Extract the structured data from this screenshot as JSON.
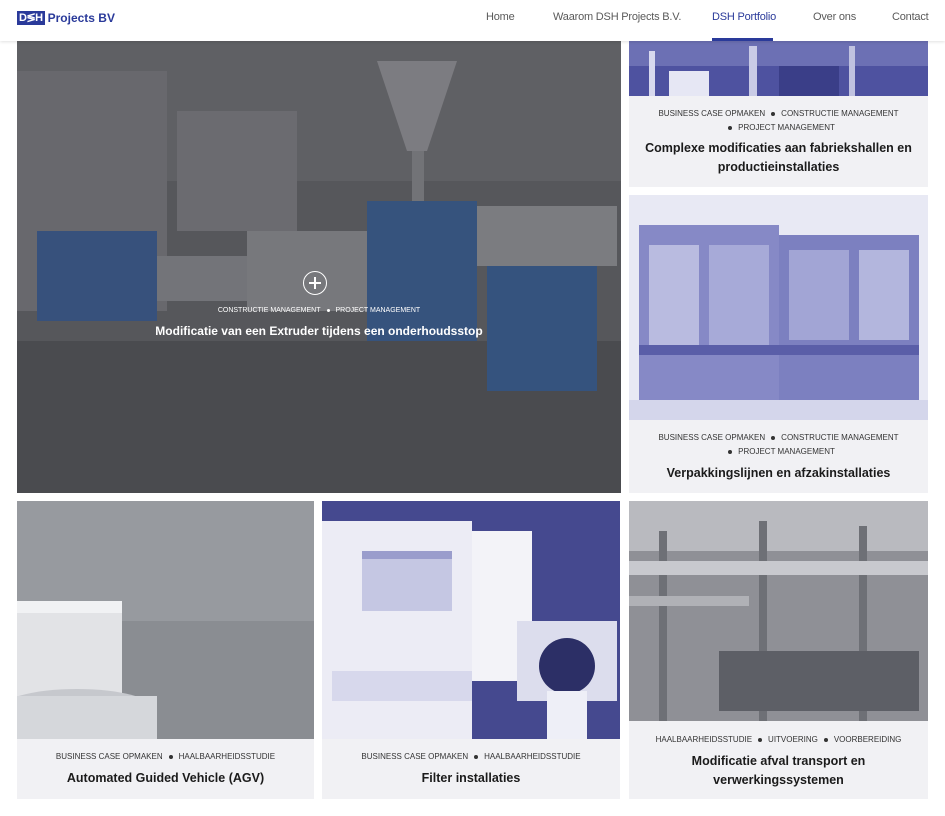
{
  "header": {
    "logo_mark": "D≶H",
    "logo_text": "Projects BV",
    "nav": [
      {
        "label": "Home"
      },
      {
        "label": "Waarom DSH Projects B.V."
      },
      {
        "label": "DSH Portfolio",
        "active": true
      },
      {
        "label": "Over ons"
      },
      {
        "label": "Contact"
      }
    ]
  },
  "featured": {
    "tags": [
      "CONSTRUCTIE MANAGEMENT",
      "PROJECT MANAGEMENT"
    ],
    "title": "Modificatie van een Extruder tijdens een onderhoudsstop"
  },
  "cards": [
    {
      "tags_line1": [
        "BUSINESS CASE OPMAKEN",
        "CONSTRUCTIE MANAGEMENT"
      ],
      "tags_line2": [
        "PROJECT MANAGEMENT"
      ],
      "title_line1": "Complexe modificaties aan fabriekshallen en",
      "title_line2": "productieinstallaties"
    },
    {
      "tags_line1": [
        "BUSINESS CASE OPMAKEN",
        "CONSTRUCTIE MANAGEMENT"
      ],
      "tags_line2": [
        "PROJECT MANAGEMENT"
      ],
      "title_line1": "Verpakkingslijnen en afzakinstallaties"
    },
    {
      "tags_line1": [
        "BUSINESS CASE OPMAKEN",
        "HAALBAARHEIDSSTUDIE"
      ],
      "title_line1": "Automated Guided Vehicle (AGV)"
    },
    {
      "tags_line1": [
        "BUSINESS CASE OPMAKEN",
        "HAALBAARHEIDSSTUDIE"
      ],
      "title_line1": "Filter installaties"
    },
    {
      "tags_line1": [
        "HAALBAARHEIDSSTUDIE",
        "UITVOERING",
        "VOORBEREIDING"
      ],
      "title_line1": "Modificatie afval transport en",
      "title_line2": "verwerkingssystemen"
    }
  ],
  "colors": {
    "brand": "#2a3a9a",
    "caption_bg": "#f1f1f4",
    "image_tint": "#4a4e9a"
  }
}
